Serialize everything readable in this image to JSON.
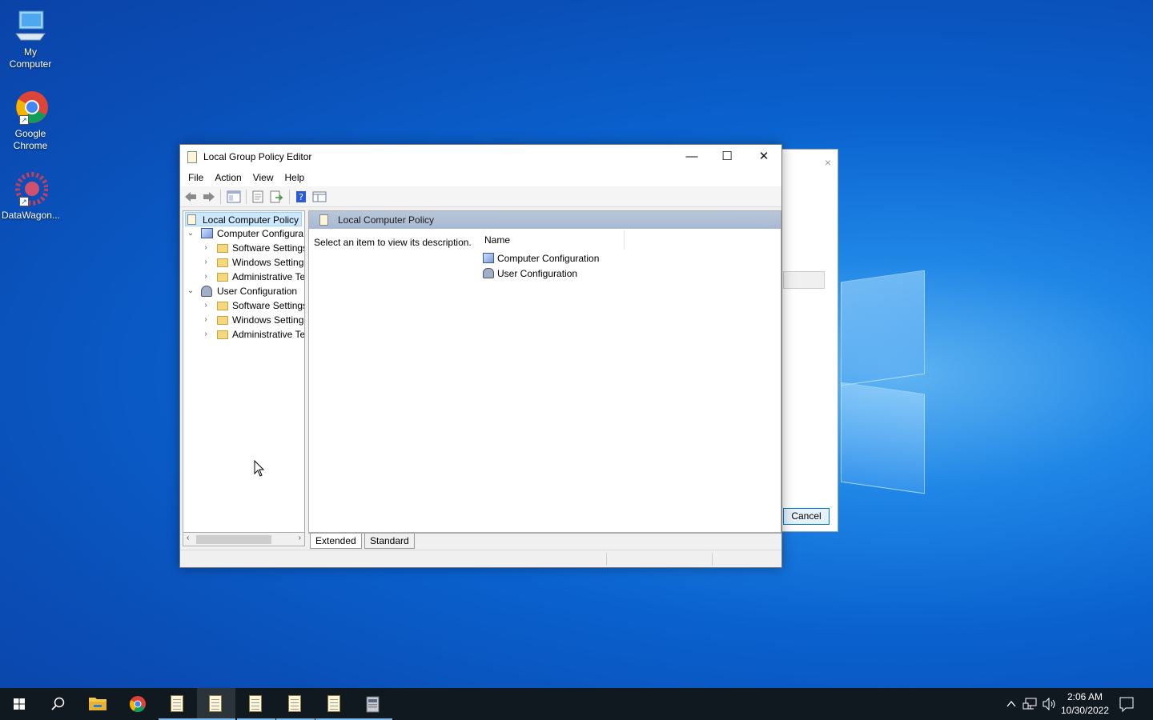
{
  "desktop": {
    "icons": [
      {
        "label": "My Computer"
      },
      {
        "label": "Google Chrome"
      },
      {
        "label": "DataWagon..."
      }
    ]
  },
  "bg_dialog": {
    "close_glyph": "×",
    "cancel_label": "Cancel"
  },
  "window": {
    "title": "Local Group Policy Editor",
    "controls": {
      "minimize": "—",
      "maximize": "☐",
      "close": "✕"
    },
    "menu": [
      "File",
      "Action",
      "View",
      "Help"
    ],
    "toolbar_icons": [
      "back-arrow-icon",
      "forward-arrow-icon",
      "show-tree-icon",
      "properties-icon",
      "export-list-icon",
      "help-icon",
      "extended-view-icon"
    ],
    "tree": {
      "root": "Local Computer Policy",
      "computer": {
        "label": "Computer Configura",
        "children": [
          "Software Settings",
          "Windows Setting",
          "Administrative Te"
        ]
      },
      "user": {
        "label": "User Configuration",
        "children": [
          "Software Settings",
          "Windows Setting",
          "Administrative Te"
        ]
      }
    },
    "right": {
      "header": "Local Computer Policy",
      "description": "Select an item to view its description.",
      "column_name": "Name",
      "items": [
        "Computer Configuration",
        "User Configuration"
      ]
    },
    "tabs": [
      "Extended",
      "Standard"
    ]
  },
  "taskbar": {
    "time": "2:06 AM",
    "date": "10/30/2022"
  },
  "colors": {
    "selection": "#cce8ff",
    "header": "#a7b8d1",
    "taskbar": "#101820"
  }
}
